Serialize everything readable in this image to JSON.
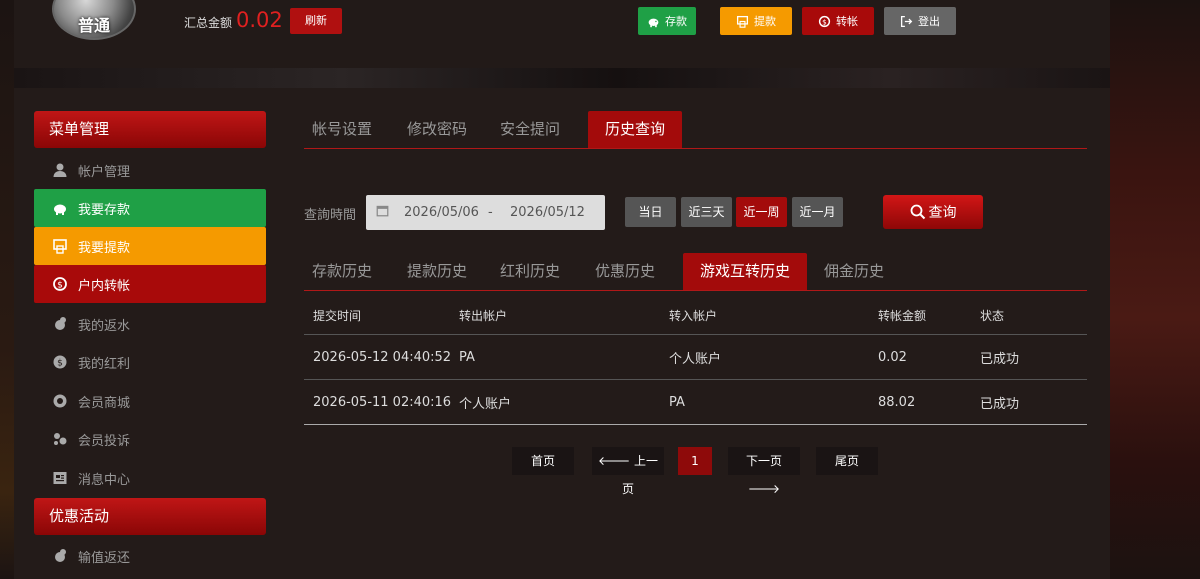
{
  "header": {
    "avatar_text": "普通",
    "total_label": "汇总金额",
    "total_value": "0.02",
    "refresh_label": "刷新",
    "buttons": [
      {
        "label": "存款",
        "color": "#1fa046",
        "icon": "piggy-bank-icon"
      },
      {
        "label": "提款",
        "color": "#f59a00",
        "icon": "atm-icon"
      },
      {
        "label": "转帐",
        "color": "#a80a0a",
        "icon": "transfer-icon"
      },
      {
        "label": "登出",
        "color": "#666666",
        "icon": "logout-icon"
      }
    ]
  },
  "sidebar": {
    "menu_header": "菜单管理",
    "items": [
      {
        "label": "帐户管理",
        "icon": "user-icon"
      },
      {
        "label": "我要存款",
        "icon": "piggy-bank-icon"
      },
      {
        "label": "我要提款",
        "icon": "atm-icon"
      },
      {
        "label": "户内转帐",
        "icon": "transfer-icon"
      },
      {
        "label": "我的返水",
        "icon": "rebate-icon"
      },
      {
        "label": "我的红利",
        "icon": "bonus-icon"
      },
      {
        "label": "会员商城",
        "icon": "shop-icon"
      },
      {
        "label": "会员投诉",
        "icon": "complaint-icon"
      },
      {
        "label": "消息中心",
        "icon": "message-icon"
      }
    ],
    "promo_header": "优惠活动",
    "promo_items": [
      {
        "label": "输值返还",
        "icon": "rebate-icon"
      }
    ]
  },
  "tabs": [
    "帐号设置",
    "修改密码",
    "安全提问",
    "历史查询"
  ],
  "active_tab": "历史查询",
  "query": {
    "label": "查詢時間",
    "start_date": "2026/05/06",
    "separator": "-",
    "end_date": "2026/05/12",
    "ranges": [
      "当日",
      "近三天",
      "近一周",
      "近一月"
    ],
    "active_range": "近一周",
    "search_label": "查询"
  },
  "subtabs": [
    "存款历史",
    "提款历史",
    "红利历史",
    "优惠历史",
    "游戏互转历史",
    "佣金历史"
  ],
  "active_subtab": "游戏互转历史",
  "table": {
    "columns": [
      "提交时间",
      "转出帐户",
      "转入帐户",
      "转帐金额",
      "状态"
    ],
    "rows": [
      [
        "2026-05-12 04:40:52",
        "PA",
        "个人账户",
        "0.02",
        "已成功"
      ],
      [
        "2026-05-11 02:40:16",
        "个人账户",
        "PA",
        "88.02",
        "已成功"
      ]
    ]
  },
  "pagination": {
    "first": "首页",
    "prev": "上一页",
    "current": "1",
    "next": "下一页",
    "last": "尾页"
  },
  "colors": {
    "accent_red": "#a80a0a",
    "deposit_green": "#1fa046",
    "withdraw_orange": "#f59a00",
    "logout_gray": "#666666"
  }
}
